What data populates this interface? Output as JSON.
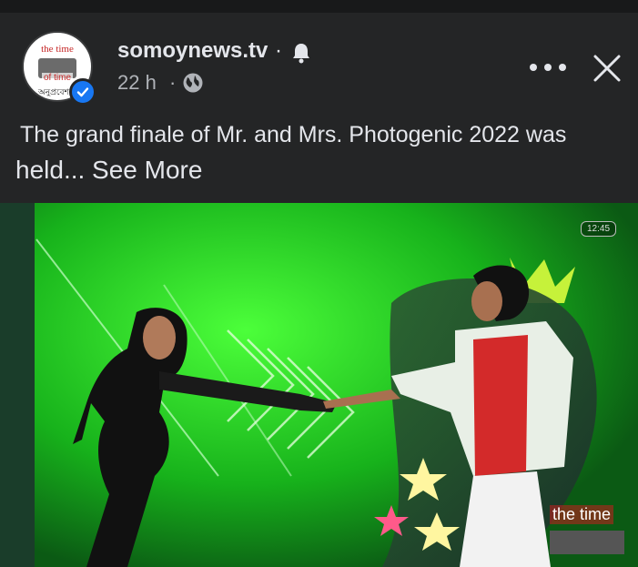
{
  "post": {
    "page_name": "somoynews.tv",
    "separator": "·",
    "time": "22 h",
    "caption_line1": "The grand finale of Mr. and Mrs. Photogenic 2022 was",
    "caption_line2": "held... See More"
  },
  "avatar": {
    "line1": "the time",
    "line2": "of time",
    "line3": "অনুপ্রবেশ"
  },
  "video": {
    "duration": "12:45",
    "watermark": "the time"
  },
  "icons": {
    "bell": "bell-icon",
    "audience": "globe-icon",
    "more": "more-icon",
    "close": "close-icon",
    "verified": "verified-icon"
  },
  "colors": {
    "background": "#242526",
    "text": "#e4e6eb",
    "secondary_text": "#b0b3b8",
    "verified": "#1877f2"
  }
}
